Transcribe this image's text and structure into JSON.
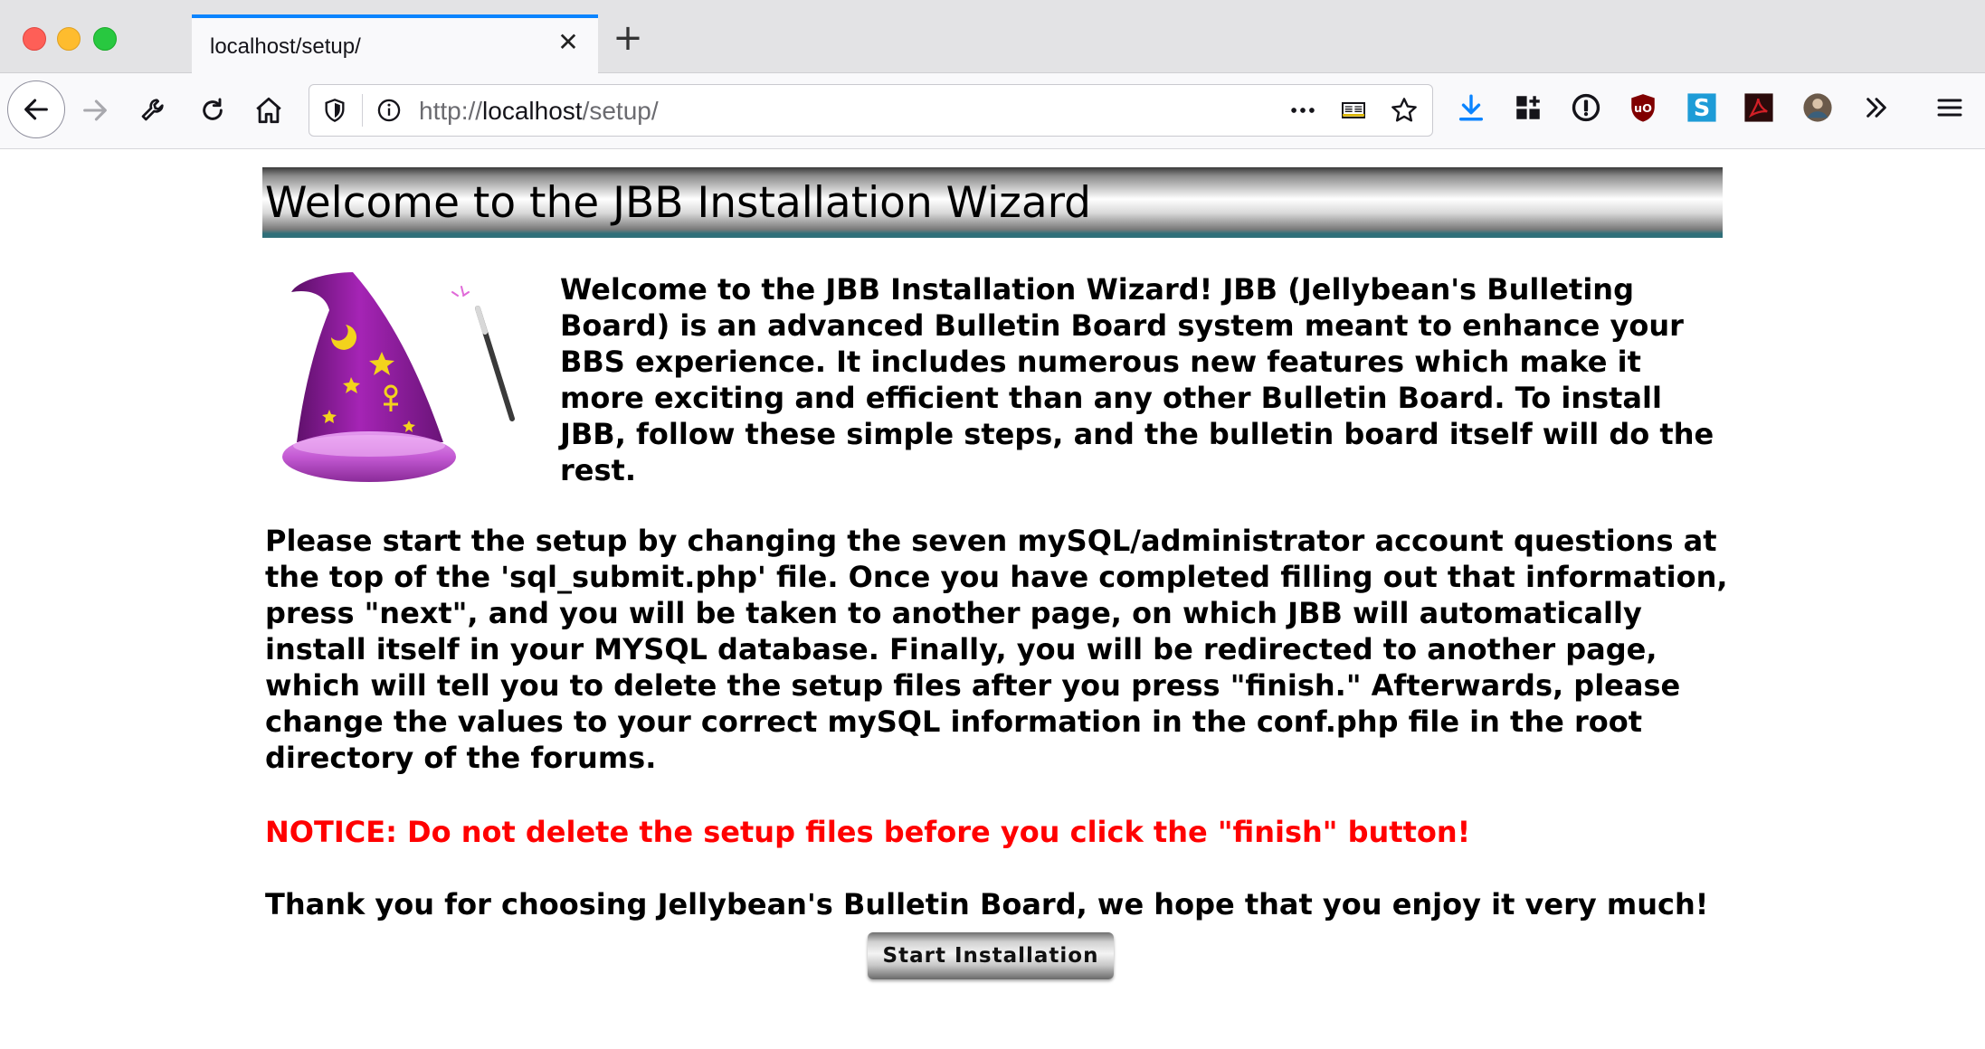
{
  "browser": {
    "tab_title": "localhost/setup/",
    "url": {
      "scheme": "http://",
      "host": "localhost",
      "path": "/setup/"
    },
    "tab_close_glyph": "✕",
    "new_tab_glyph": "+",
    "icons": {
      "back": "back-arrow-icon",
      "forward": "forward-arrow-icon",
      "tools": "wrench-icon",
      "reload": "reload-icon",
      "home": "home-icon",
      "tracking": "shield-icon",
      "site_info": "info-icon",
      "page_actions": "more-dots-icon",
      "reader": "reader-mode-icon",
      "bookmark": "star-icon",
      "downloads": "download-icon",
      "library": "library-icon",
      "password": "password-manager-icon",
      "ublock": "ublock-icon",
      "extension_s": "s-extension-icon",
      "pdf": "pdf-icon",
      "profile": "profile-avatar-icon",
      "overflow": "chevrons-icon",
      "menu": "hamburger-menu-icon"
    },
    "colors": {
      "tab_accent": "#0a84ff",
      "download_icon": "#0a84ff",
      "ublock": "#800000",
      "s_extension": "#1e9cd7",
      "pdf": "#d21f26"
    }
  },
  "page": {
    "banner_title": "Welcome to the JBB Installation Wizard",
    "intro": "Welcome to the JBB Installation Wizard! JBB (Jellybean's Bulleting Board) is an advanced Bulletin Board system meant to enhance your BBS experience. It includes numerous new features which make it more exciting and efficient than any other Bulletin Board. To install JBB, follow these simple steps, and the bulletin board itself will do the rest.",
    "instructions": "Please start the setup by changing the seven mySQL/administrator account questions at the top of the 'sql_submit.php' file. Once you have completed filling out that information, press \"next\", and you will be taken to another page, on which JBB will automatically install itself in your MYSQL database. Finally, you will be redirected to another page, which will tell you to delete the setup files after you press \"finish.\" Afterwards, please change the values to your correct mySQL information in the conf.php file in the root directory of the forums.",
    "notice": "NOTICE: Do not delete the setup files before you click the \"finish\" button!",
    "thanks": "Thank you for choosing Jellybean's Bulletin Board, we hope that you enjoy it very much!",
    "start_button": "Start Installation",
    "image": "wizard-hat-icon",
    "colors": {
      "notice": "#ff0000",
      "hat": "#9b1fa8",
      "banner_underline": "#2f6f79"
    }
  }
}
